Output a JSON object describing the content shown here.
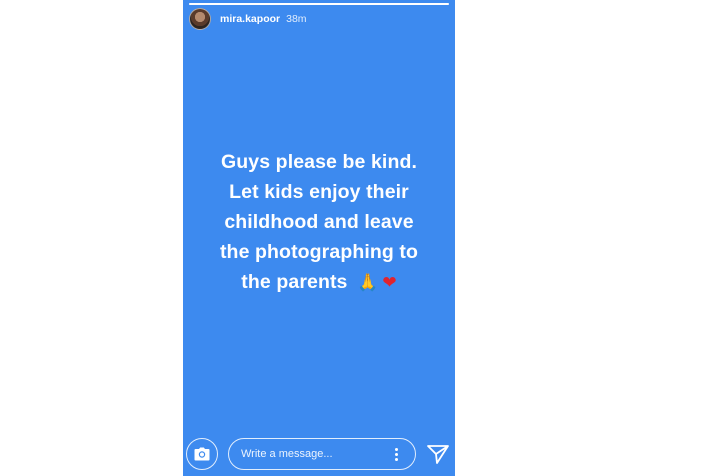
{
  "story": {
    "username": "mira.kapoor",
    "timestamp": "38m",
    "progress": 1.0,
    "background_color": "#3d8aef",
    "message_lines": [
      "Guys please be kind.",
      "Let kids enjoy their",
      "childhood and leave",
      "the photographing to",
      "the parents"
    ],
    "emojis": [
      "🙏",
      "❤"
    ]
  },
  "footer": {
    "message_placeholder": "Write a message...",
    "icons": [
      "camera-icon",
      "more-options-icon",
      "send-icon"
    ]
  }
}
